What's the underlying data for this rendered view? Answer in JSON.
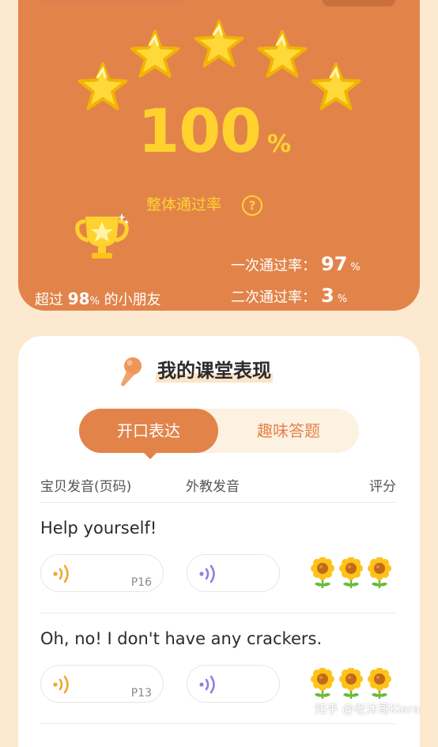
{
  "result": {
    "stars_earned": 5,
    "stars_total": 5,
    "overall_value": "100",
    "overall_unit": "%",
    "overall_label": "整体通过率",
    "help_symbol": "?",
    "exceed_prefix": "超过",
    "exceed_value": "98",
    "exceed_unit": "%",
    "exceed_suffix": "的小朋友",
    "first_pass_label": "一次通过率：",
    "first_pass_value": "97",
    "first_pass_unit": "%",
    "second_pass_label": "二次通过率：",
    "second_pass_value": "3",
    "second_pass_unit": "%"
  },
  "performance": {
    "title": "我的课堂表现",
    "tabs": [
      {
        "label": "开口表达",
        "active": true
      },
      {
        "label": "趣味答题",
        "active": false
      }
    ],
    "columns": {
      "baby": "宝贝发音(页码)",
      "teacher": "外教发音",
      "score": "评分"
    },
    "items": [
      {
        "sentence": "Help yourself!",
        "page": "P16",
        "score": 3
      },
      {
        "sentence": "Oh, no! I don't have any crackers.",
        "page": "P13",
        "score": 3
      }
    ]
  },
  "icons": {
    "star": "star-icon",
    "trophy": "trophy-icon",
    "help": "question-circle-icon",
    "mic": "microphone-icon",
    "baby_audio": "sound-wave-icon",
    "teacher_audio": "sound-wave-icon",
    "score": "sunflower-icon"
  },
  "colors": {
    "card_orange": "#e2844a",
    "gold": "#ffd22e",
    "baby_wave": "#f0a830",
    "teacher_wave": "#8f7ee8",
    "page_bg": "#fde9cf"
  },
  "watermark": "知乎 @老沐哥Klara"
}
